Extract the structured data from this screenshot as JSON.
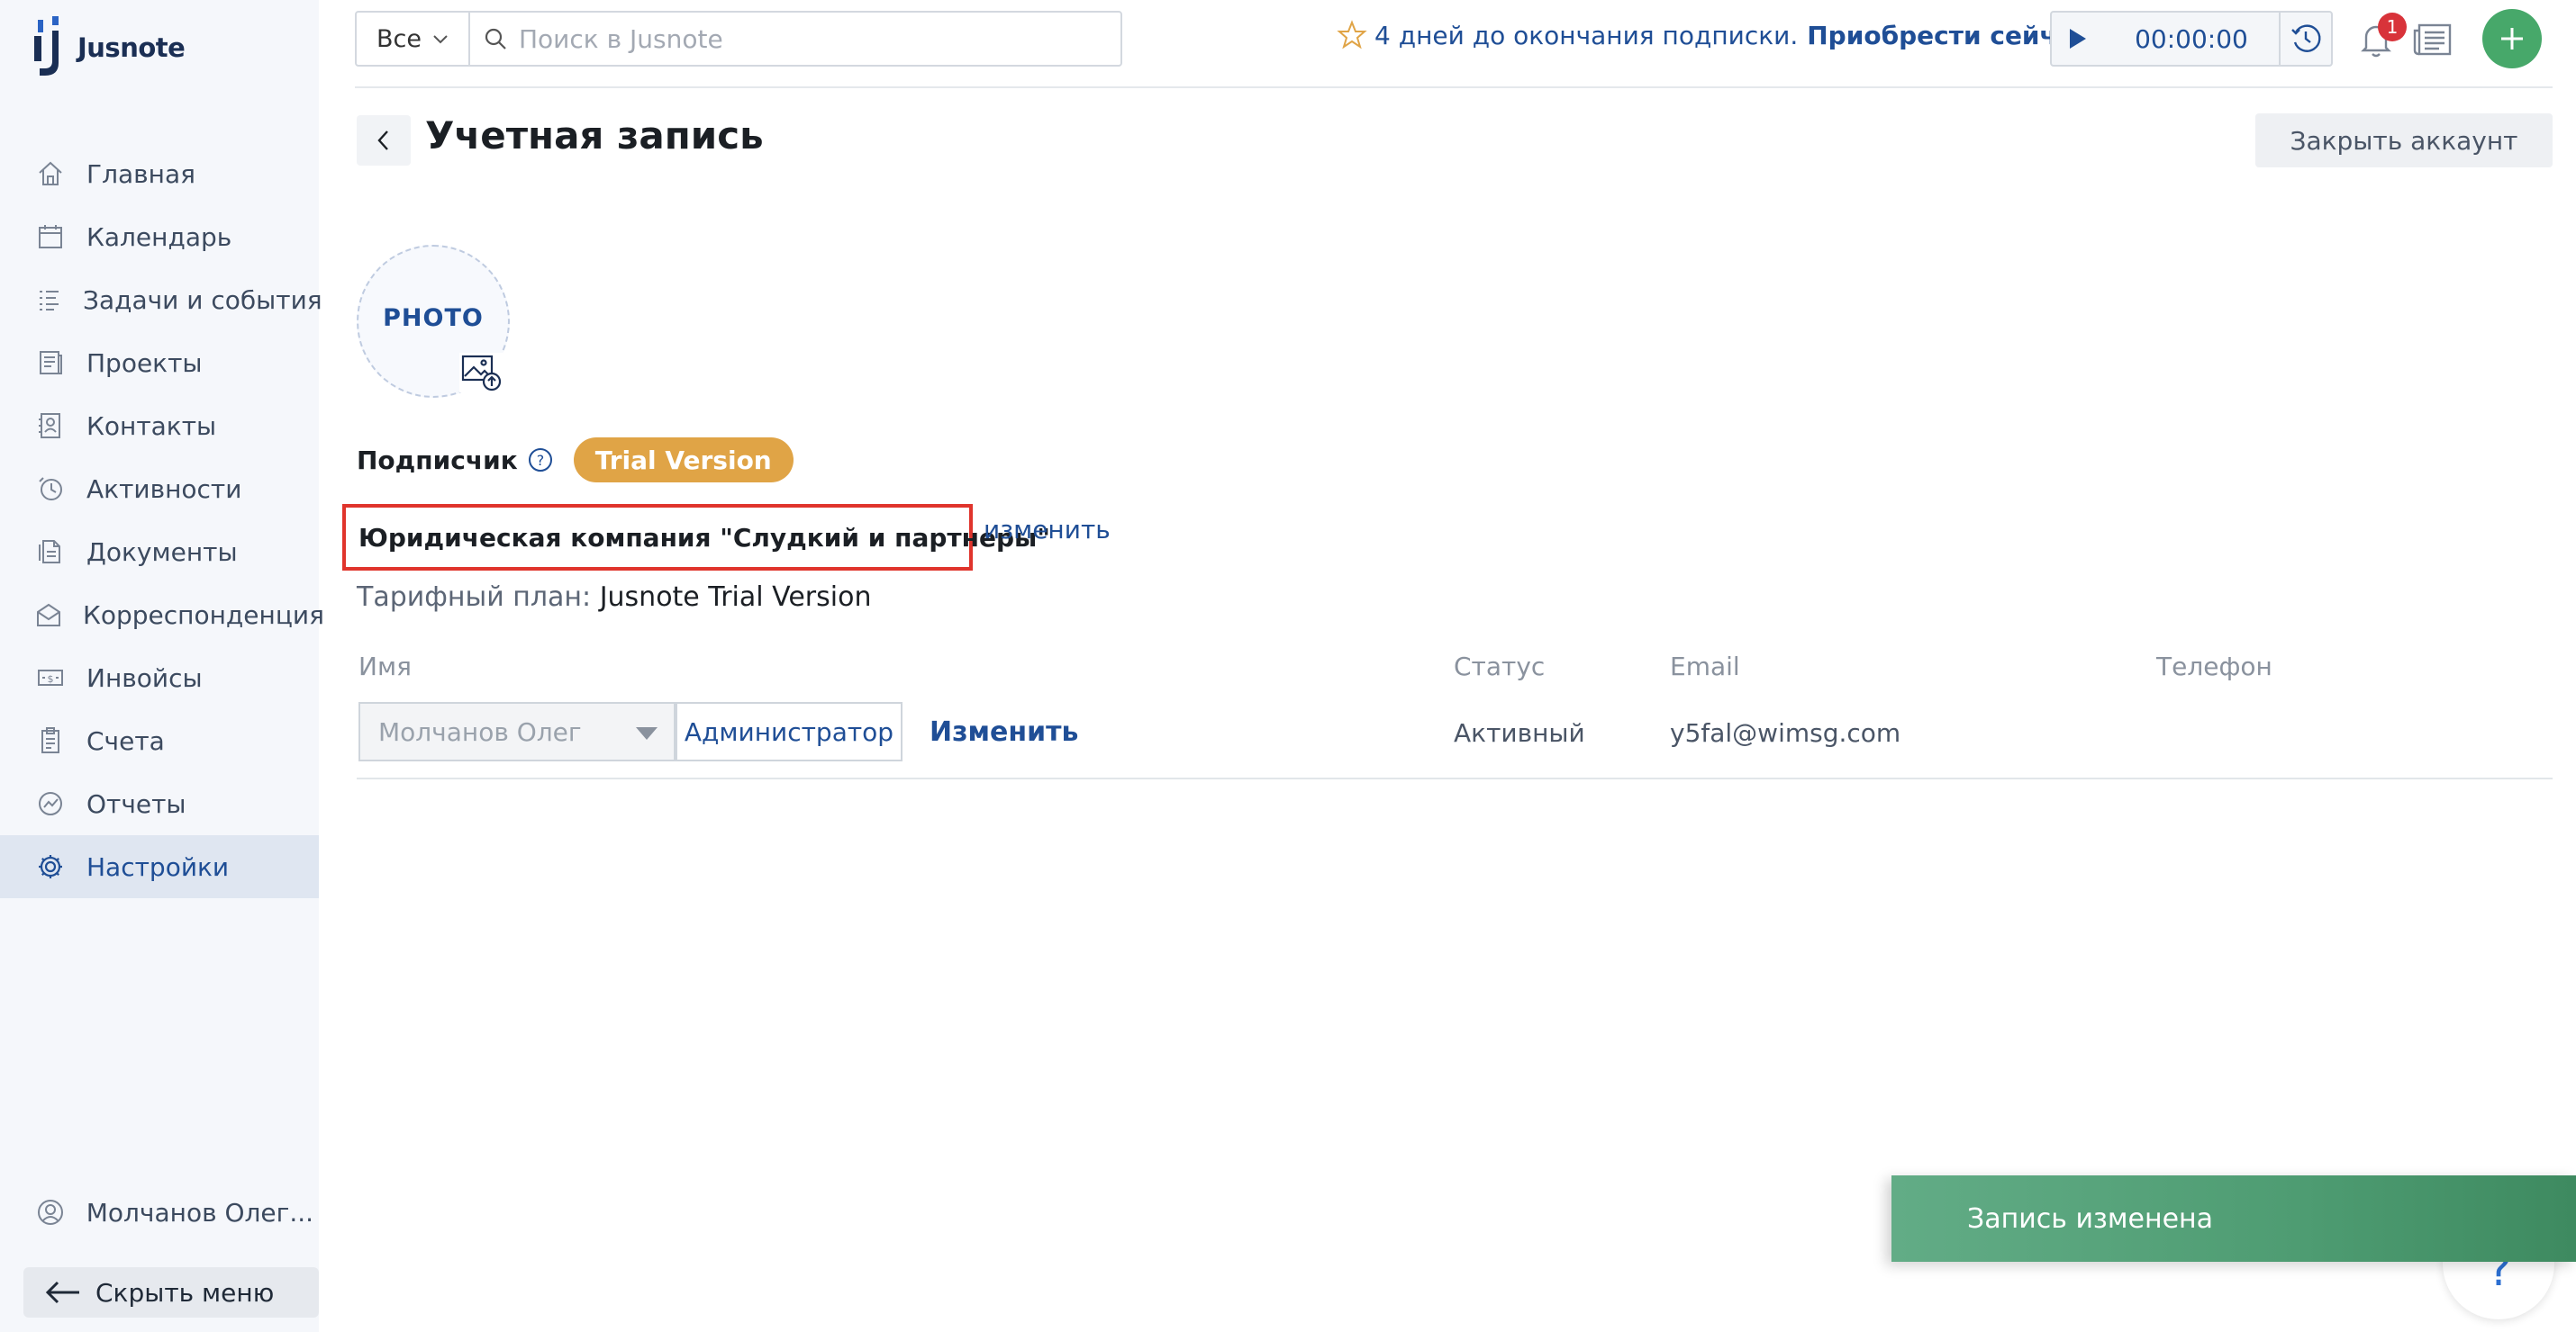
{
  "app": {
    "logo_text": "Jusnote"
  },
  "sidebar": {
    "items": [
      {
        "label": "Главная",
        "icon": "home-icon"
      },
      {
        "label": "Календарь",
        "icon": "calendar-icon"
      },
      {
        "label": "Задачи и события",
        "icon": "tasks-icon"
      },
      {
        "label": "Проекты",
        "icon": "projects-icon"
      },
      {
        "label": "Контакты",
        "icon": "contacts-icon"
      },
      {
        "label": "Активности",
        "icon": "activity-icon"
      },
      {
        "label": "Документы",
        "icon": "documents-icon"
      },
      {
        "label": "Корреспонденция",
        "icon": "mail-icon"
      },
      {
        "label": "Инвойсы",
        "icon": "invoice-icon"
      },
      {
        "label": "Счета",
        "icon": "accounts-icon"
      },
      {
        "label": "Отчеты",
        "icon": "reports-icon"
      },
      {
        "label": "Настройки",
        "icon": "gear-icon",
        "active": true
      }
    ],
    "user_label": "Молчанов Олег...",
    "hide_menu_label": "Скрыть меню"
  },
  "topbar": {
    "filter_value": "Все",
    "search_placeholder": "Поиск в Jusnote",
    "subscription_text": "4 дней до окончания подписки.",
    "buy_now": "Приобрести сейчас",
    "timer": "00:00:00",
    "notifications_count": "1"
  },
  "page": {
    "title": "Учетная запись",
    "close_account": "Закрыть аккаунт",
    "photo_label": "PHOTO",
    "subscriber_label": "Подписчик",
    "trial_badge": "Trial Version",
    "company_name": "Юридическая компания \"Слудкий и партнеры\"",
    "company_edit": "изменить",
    "plan_label": "Тарифный план:",
    "plan_value": "Jusnote Trial Version"
  },
  "table": {
    "headers": {
      "name": "Имя",
      "status": "Статус",
      "email": "Email",
      "phone": "Телефон"
    },
    "rows": [
      {
        "name": "Молчанов Олег",
        "role": "Администратор",
        "edit": "Изменить",
        "status": "Активный",
        "email": "y5fal@wimsg.com",
        "phone": ""
      }
    ]
  },
  "toast": {
    "message": "Запись изменена"
  },
  "help": {
    "glyph": "?"
  },
  "colors": {
    "accent": "#1f4e96",
    "trial": "#e0a446",
    "success": "#4e9c72",
    "highlight": "#e0342c",
    "add": "#47a86a"
  }
}
